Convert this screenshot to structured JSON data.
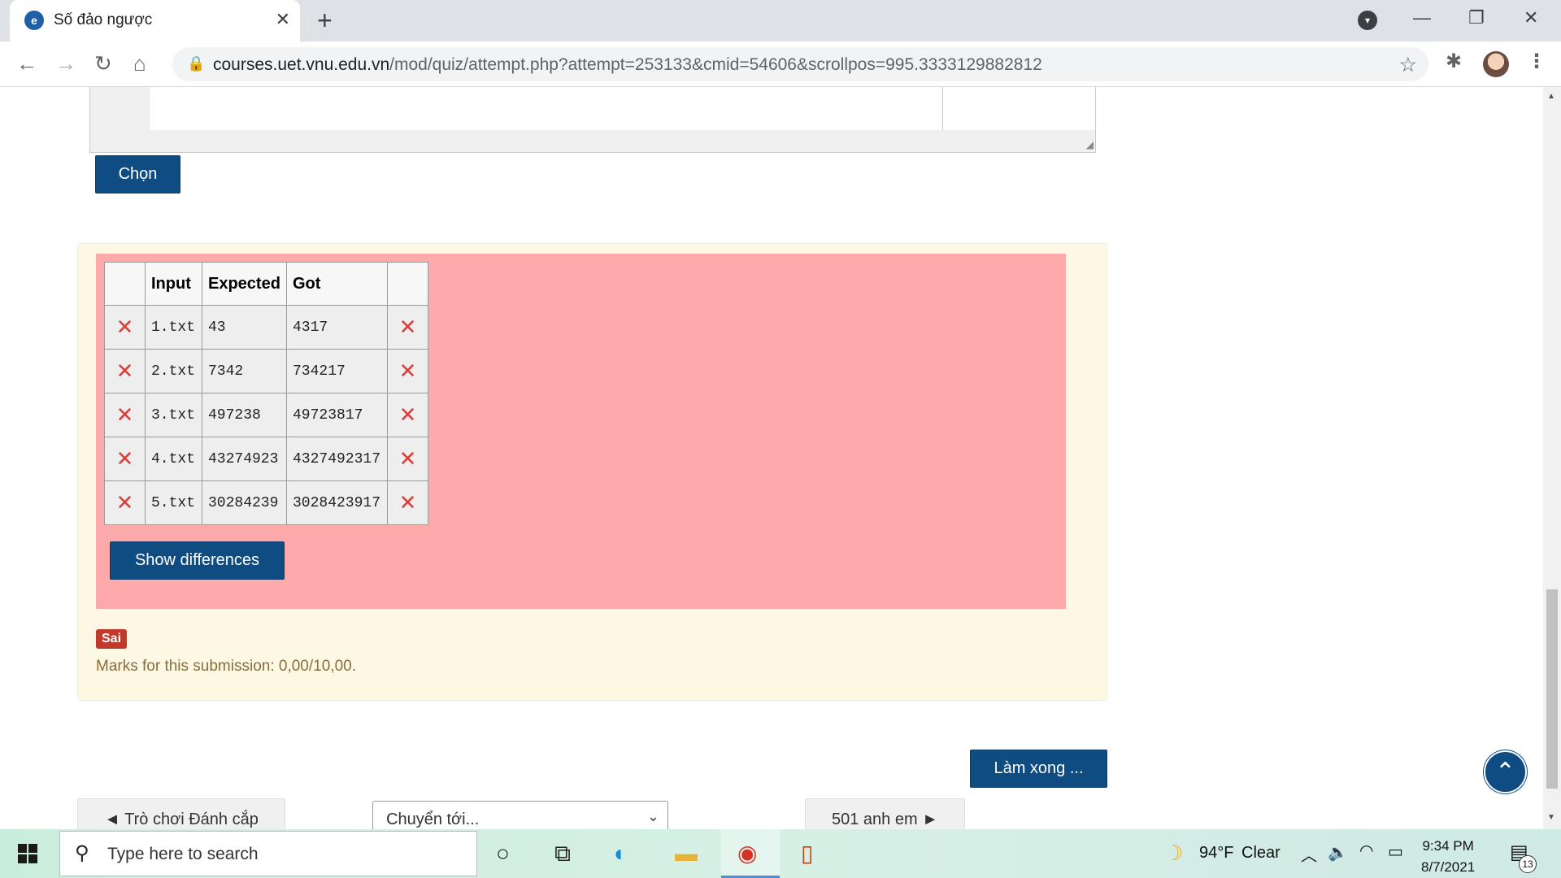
{
  "browser": {
    "tab_title": "Số đảo ngược",
    "url_host": "courses.uet.vnu.edu.vn",
    "url_path": "/mod/quiz/attempt.php?attempt=253133&cmid=54606&scrollpos=995.3333129882812",
    "icons": {
      "favicon": "e",
      "close": "✕",
      "new_tab": "+",
      "tab_search": "▾",
      "minimize": "—",
      "restore": "❐",
      "window_close": "✕",
      "back": "←",
      "forward": "→",
      "reload": "↻",
      "home": "⌂",
      "lock": "🔒",
      "star": "☆",
      "extensions": "✱",
      "menu": "⋮"
    }
  },
  "quiz": {
    "select_button": "Chọn",
    "table": {
      "headers": [
        "",
        "Input",
        "Expected",
        "Got",
        ""
      ],
      "rows": [
        {
          "input": "1.txt",
          "expected": "43",
          "got": "4317"
        },
        {
          "input": "2.txt",
          "expected": "7342",
          "got": "734217"
        },
        {
          "input": "3.txt",
          "expected": "497238",
          "got": "49723817"
        },
        {
          "input": "4.txt",
          "expected": "43274923",
          "got": "4327492317"
        },
        {
          "input": "5.txt",
          "expected": "30284239",
          "got": "3028423917"
        }
      ],
      "fail_icon": "✕"
    },
    "show_differences_button": "Show differences",
    "status_badge": "Sai",
    "marks_text": "Marks for this submission: 0,00/10,00.",
    "finish_button": "Làm xong ...",
    "prev_link": "◄ Trò chơi Đánh cắp",
    "jump_select": "Chuyển tới...",
    "next_link": "501 anh em ►",
    "back_to_top_icon": "⌃",
    "select_chevron": "⌄",
    "resize_grip": "◢"
  },
  "taskbar": {
    "search_placeholder": "Type here to search",
    "search_icon": "⚲",
    "weather_icon": "☽",
    "weather_temp": "94°F",
    "weather_desc": "Clear",
    "time": "9:34 PM",
    "date": "8/7/2021",
    "notification_count": "13",
    "icons": {
      "cortana": "○",
      "task_view": "⧉",
      "edge": "◐",
      "explorer": "▬",
      "chrome": "◉",
      "office": "▯",
      "chevron_up": "︿",
      "volume": "🔈",
      "wifi": "◠",
      "battery": "▭",
      "notifications": "▤"
    }
  },
  "colors": {
    "primary": "#0f4c81",
    "result_fail_bg": "#ffaaaa",
    "feedback_bg": "#fcf8e3",
    "badge_wrong": "#c0392b",
    "marks_text": "#8a6d3b",
    "fail_icon": "#e53935"
  }
}
